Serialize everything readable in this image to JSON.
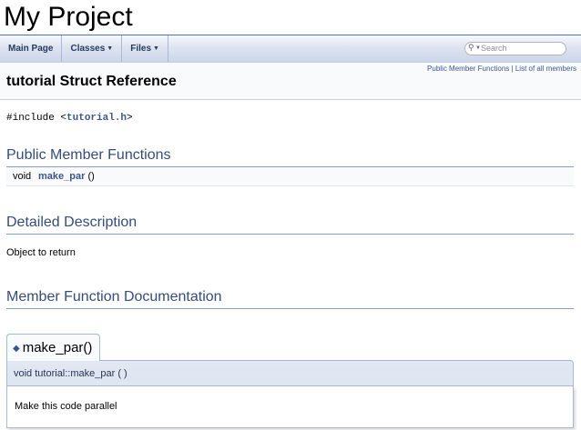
{
  "project": {
    "name": "My Project"
  },
  "nav": {
    "tabs": [
      {
        "label": "Main Page",
        "dropdown": false
      },
      {
        "label": "Classes",
        "dropdown": true
      },
      {
        "label": "Files",
        "dropdown": true
      }
    ],
    "search_placeholder": "Search"
  },
  "header": {
    "summary_links": [
      "Public Member Functions",
      "List of all members"
    ],
    "summary_sep": "|",
    "title": "tutorial Struct Reference"
  },
  "include": {
    "prefix": "#include <",
    "file": "tutorial.h",
    "suffix": ">"
  },
  "public_member_functions": {
    "heading": "Public Member Functions",
    "rows": [
      {
        "type": "void",
        "name": "make_par",
        "args": "()"
      }
    ]
  },
  "detailed_description": {
    "heading": "Detailed Description",
    "text": "Object to return"
  },
  "member_function_documentation": {
    "heading": "Member Function Documentation",
    "tab_title": "make_par()",
    "prototype": "void tutorial::make_par ( )",
    "doc": "Make this code parallel"
  },
  "colors": {
    "link": "#3d578c",
    "heading": "#354c7b",
    "border": "#a8b8d9",
    "nav_bg": "#dde3f0"
  },
  "icons": {
    "tab_marker": "diamond-icon",
    "search": "search-icon",
    "dropdown": "caret-down-icon"
  }
}
